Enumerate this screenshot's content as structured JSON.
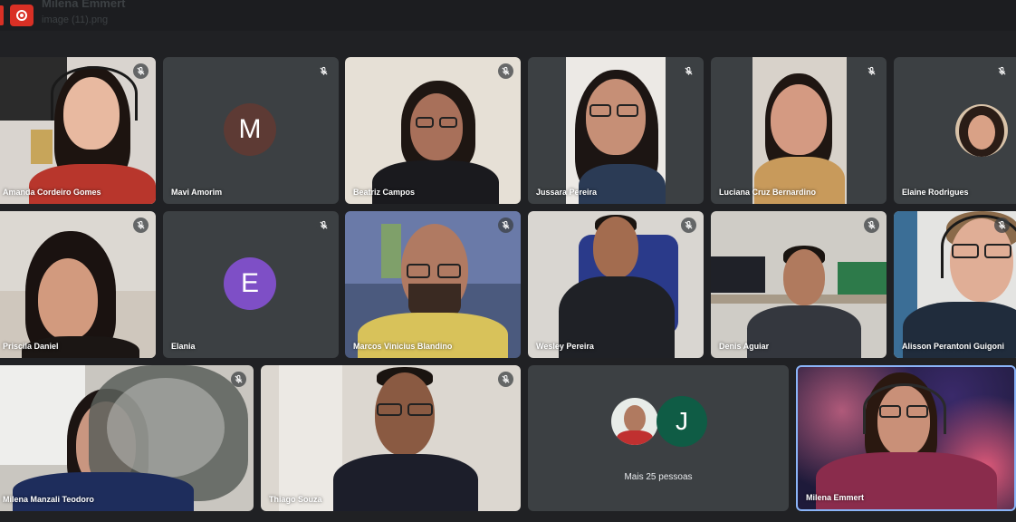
{
  "header": {
    "title": "Milena Emmert",
    "subtitle": "image (11).png",
    "record_icon": "record-icon"
  },
  "mic_icon": "mic-off-icon",
  "participants": [
    {
      "name": "Amanda Cordeiro Gomes",
      "kind": "video"
    },
    {
      "name": "Mavi Amorim",
      "kind": "initial",
      "initial": "M",
      "color": "#5d3a34"
    },
    {
      "name": "Beatriz Campos",
      "kind": "video"
    },
    {
      "name": "Jussara Pereira",
      "kind": "video"
    },
    {
      "name": "Luciana Cruz Bernardino",
      "kind": "video"
    },
    {
      "name": "Elaine Rodrigues",
      "kind": "photo"
    },
    {
      "name": "Priscila Daniel",
      "kind": "video"
    },
    {
      "name": "Elania",
      "kind": "initial",
      "initial": "E",
      "color": "#7e4fc6"
    },
    {
      "name": "Marcos Vinicius Blandino",
      "kind": "video"
    },
    {
      "name": "Wesley Pereira",
      "kind": "video"
    },
    {
      "name": "Denis Aguiar",
      "kind": "video"
    },
    {
      "name": "Alisson Perantoni Guigoni",
      "kind": "video"
    },
    {
      "name": "Milena Manzali Teodoro",
      "kind": "video"
    },
    {
      "name": "Thiago Souza",
      "kind": "video"
    },
    {
      "name": "Milena Emmert",
      "kind": "video"
    }
  ],
  "more_people": {
    "label": "Mais 25 pessoas",
    "initial": "J",
    "initial_color": "#0f5c45"
  }
}
